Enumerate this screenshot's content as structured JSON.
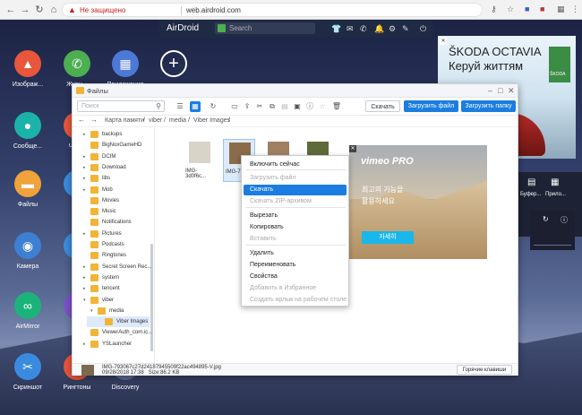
{
  "browser": {
    "security_label": "Не защищено",
    "url": "web.airdroid.com"
  },
  "airdroid": {
    "logo": "AirDroid",
    "search_placeholder": "Search"
  },
  "desktop_icons": [
    {
      "label": "Изображ...",
      "icon": "image-icon",
      "color": "#e8563c"
    },
    {
      "label": "Журн...",
      "icon": "phone-icon",
      "color": "#4caf50"
    },
    {
      "label": "Приложения",
      "icon": "apps-icon",
      "color": "#4d79d6"
    },
    {
      "label": "",
      "icon": "plus-icon",
      "color": "transparent"
    },
    {
      "label": "Сообще...",
      "icon": "chat-icon",
      "color": "#1bb3a9"
    },
    {
      "label": "Часто",
      "icon": "call-icon",
      "color": "#e8563c"
    },
    {
      "label": "Файлы",
      "icon": "folder-icon",
      "color": "#f0a23b"
    },
    {
      "label": "Ко",
      "icon": "contacts-icon",
      "color": "#3c8de0"
    },
    {
      "label": "Камера",
      "icon": "camera-icon",
      "color": "#3d7fd2"
    },
    {
      "label": "E",
      "icon": "screen-icon",
      "color": "#3c8de0"
    },
    {
      "label": "AirMirror",
      "icon": "binoculars-icon",
      "color": "#1bb37a"
    },
    {
      "label": "M",
      "icon": "music-icon",
      "color": "#7a54c9"
    },
    {
      "label": "Скриншот",
      "icon": "scissors-icon",
      "color": "#3a8be0"
    },
    {
      "label": "Рингтоны",
      "icon": "bell-icon",
      "color": "#e8563c"
    },
    {
      "label": "Discovery",
      "icon": "compass-icon",
      "color": "#5a6a95"
    }
  ],
  "window": {
    "title": "Файлы",
    "search_placeholder": "Поиск",
    "download_btn": "Скачать",
    "upload_file_btn": "Загрузить файл",
    "upload_folder_btn": "Загрузить папку"
  },
  "breadcrumb": [
    "Карта памяти",
    "viber",
    "media",
    "Viber Images"
  ],
  "tree": [
    {
      "name": "backups",
      "arrow": "▸"
    },
    {
      "name": "BigNoxGameHD",
      "arrow": ""
    },
    {
      "name": "DCIM",
      "arrow": "▸"
    },
    {
      "name": "Download",
      "arrow": "▸"
    },
    {
      "name": "libs",
      "arrow": "▸"
    },
    {
      "name": "Mob",
      "arrow": "▸"
    },
    {
      "name": "Movies",
      "arrow": ""
    },
    {
      "name": "Music",
      "arrow": ""
    },
    {
      "name": "Notifications",
      "arrow": ""
    },
    {
      "name": "Pictures",
      "arrow": "▸"
    },
    {
      "name": "Podcasts",
      "arrow": ""
    },
    {
      "name": "Ringtones",
      "arrow": ""
    },
    {
      "name": "Secret Screen Rec...",
      "arrow": "▸"
    },
    {
      "name": "system",
      "arrow": "▸"
    },
    {
      "name": "tencent",
      "arrow": "▸"
    },
    {
      "name": "viber",
      "arrow": "▾"
    },
    {
      "name": "media",
      "arrow": "▾"
    },
    {
      "name": "Viber Images",
      "arrow": ""
    },
    {
      "name": "ViewerAuth_com.ic...",
      "arrow": ""
    },
    {
      "name": "YSLauncher",
      "arrow": "▸"
    }
  ],
  "files": [
    {
      "name": "IMG-3d0f6c..."
    },
    {
      "name": "IMG-793..."
    },
    {
      "name": ""
    },
    {
      "name": ""
    }
  ],
  "context_menu": [
    {
      "label": "Включить сейчас",
      "state": "normal"
    },
    {
      "label": "Загрузить файл",
      "state": "disabled"
    },
    {
      "label": "Скачать",
      "state": "highlighted"
    },
    {
      "label": "Скачать ZIP-архивом",
      "state": "disabled"
    },
    {
      "label": "Вырезать",
      "state": "normal"
    },
    {
      "label": "Копировать",
      "state": "normal"
    },
    {
      "label": "Вставить",
      "state": "disabled"
    },
    {
      "label": "Удалить",
      "state": "normal"
    },
    {
      "label": "Переименовать",
      "state": "normal"
    },
    {
      "label": "Свойства",
      "state": "normal"
    },
    {
      "label": "Добавить в Избранное",
      "state": "disabled"
    },
    {
      "label": "Создать ярлык на рабочем столе",
      "state": "disabled"
    }
  ],
  "status": {
    "filename": "IMG-793067c27d24187945509f22ac494895-V.jpg",
    "date": "09/28/2018 17:38",
    "size": "Size:86.2 KB",
    "hotkeys": "Горячие клавиши"
  },
  "ads": {
    "skoda_line1": "ŠKODA OCTAVIA",
    "skoda_line2": "Керуй життям",
    "skoda_logo": "ŠKODA",
    "vimeo_logo": "vimeo PRO",
    "vimeo_k1": "최고의 기능을",
    "vimeo_k2": "활용하세요",
    "vimeo_cta": "자세히"
  },
  "right_panel": {
    "item1": "Буфер...",
    "item2": "Прило..."
  }
}
